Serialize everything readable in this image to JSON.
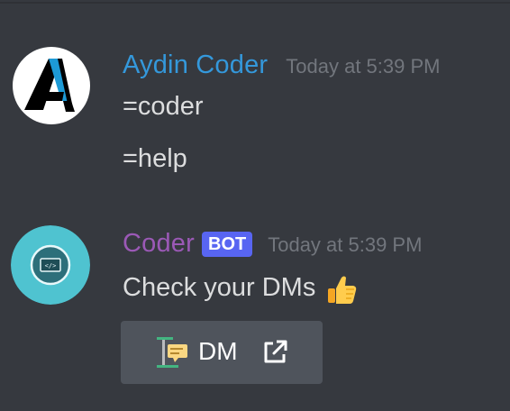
{
  "messages": [
    {
      "username": "Aydin Coder",
      "username_color": "#3498db",
      "timestamp": "Today at 5:39 PM",
      "avatar_icon": "letter-a-logo-icon",
      "lines": [
        "=coder",
        "=help"
      ]
    },
    {
      "username": "Coder",
      "username_color": "#9b59b6",
      "bot_tag": "BOT",
      "timestamp": "Today at 5:39 PM",
      "avatar_icon": "code-terminal-icon",
      "lines": [
        "Check your DMs"
      ],
      "reaction_emoji": "thumbs-up-icon",
      "button": {
        "label": "DM",
        "emoji": "dm-emoji-icon",
        "link_icon": "external-link-icon"
      }
    }
  ],
  "colors": {
    "background": "#36393f",
    "text": "#dcddde",
    "timestamp": "#72767d",
    "bot_tag": "#5865f2",
    "button": "#4f545c"
  }
}
